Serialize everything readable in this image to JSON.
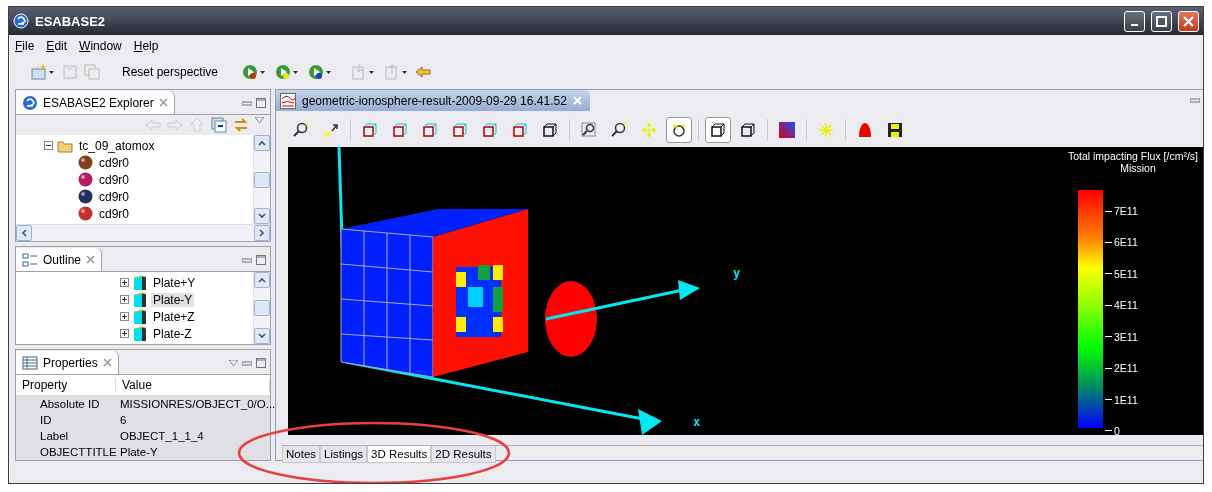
{
  "window": {
    "title": "ESABASE2"
  },
  "menu": [
    "File",
    "Edit",
    "Window",
    "Help"
  ],
  "toolbar": {
    "reset_button": "Reset perspective"
  },
  "explorer": {
    "title": "ESABASE2 Explorer",
    "tree": [
      {
        "label": "tc_09_atomox",
        "expanded": true,
        "children": [
          {
            "label": "cd9r0"
          },
          {
            "label": "cd9r0"
          },
          {
            "label": "cd9r0"
          },
          {
            "label": "cd9r0"
          }
        ]
      }
    ]
  },
  "outline": {
    "title": "Outline",
    "items": [
      {
        "label": "Plate+Y",
        "selected": false
      },
      {
        "label": "Plate-Y",
        "selected": true
      },
      {
        "label": "Plate+Z",
        "selected": false
      },
      {
        "label": "Plate-Z",
        "selected": false
      }
    ]
  },
  "properties": {
    "title": "Properties",
    "columns": [
      "Property",
      "Value"
    ],
    "rows": [
      {
        "property": "Absolute ID",
        "value": "MISSIONRES/OBJECT_0/O..."
      },
      {
        "property": "ID",
        "value": "6"
      },
      {
        "property": "Label",
        "value": "OBJECT_1_1_4"
      },
      {
        "property": "OBJECTTITLE",
        "value": "Plate-Y"
      }
    ]
  },
  "editor": {
    "tab": "geometric-ionosphere-result-2009-09-29 16.41.52",
    "view_toolbar": [
      {
        "kind": "zoom",
        "pressed": false
      },
      {
        "kind": "pick",
        "pressed": false
      },
      {
        "kind": "separator"
      },
      {
        "kind": "cube",
        "pressed": false
      },
      {
        "kind": "cube",
        "pressed": false
      },
      {
        "kind": "cube",
        "pressed": false
      },
      {
        "kind": "cube",
        "pressed": false
      },
      {
        "kind": "cube",
        "pressed": false
      },
      {
        "kind": "cube",
        "pressed": false
      },
      {
        "kind": "wire",
        "pressed": false
      },
      {
        "kind": "separator"
      },
      {
        "kind": "zoombox",
        "pressed": false
      },
      {
        "kind": "zoom",
        "pressed": false
      },
      {
        "kind": "pan",
        "pressed": false
      },
      {
        "kind": "rotate",
        "pressed": true
      },
      {
        "kind": "separator"
      },
      {
        "kind": "wire",
        "pressed": true
      },
      {
        "kind": "wire",
        "pressed": false
      },
      {
        "kind": "separator"
      },
      {
        "kind": "gradient",
        "pressed": false
      },
      {
        "kind": "separator"
      },
      {
        "kind": "light",
        "pressed": false
      },
      {
        "kind": "separator"
      },
      {
        "kind": "marker",
        "pressed": false
      },
      {
        "kind": "save",
        "pressed": false
      }
    ],
    "scene": {
      "axis_labels": [
        "y",
        "x"
      ]
    },
    "legend": {
      "title": "Total impacting Flux [/cm²/s]",
      "subtitle": "Mission",
      "ticks": [
        "7E11",
        "6E11",
        "5E11",
        "4E11",
        "3E11",
        "2E11",
        "1E11",
        "0"
      ]
    },
    "bottom_tabs": [
      {
        "label": "Notes",
        "selected": false
      },
      {
        "label": "Listings",
        "selected": false
      },
      {
        "label": "3D Results",
        "selected": true
      },
      {
        "label": "2D Results",
        "selected": false
      }
    ]
  }
}
